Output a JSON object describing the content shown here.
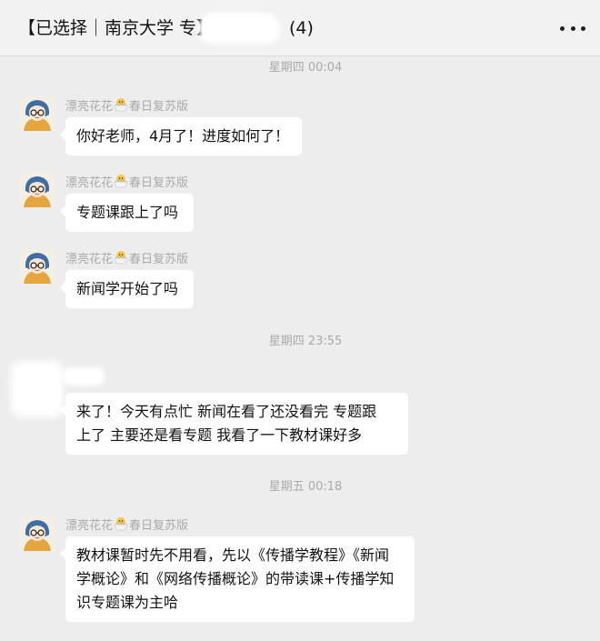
{
  "header": {
    "title": "【已选择｜南京大学 专】",
    "count": "(4)",
    "more_icon": "more-dots-icon"
  },
  "messages": [
    {
      "timestamp": "星期四 00:04",
      "sender_prefix": "漂亮花花",
      "sender_suffix": "春日复苏版",
      "text": "你好老师，4月了！进度如何了！"
    },
    {
      "sender_prefix": "漂亮花花",
      "sender_suffix": "春日复苏版",
      "text": "专题课跟上了吗"
    },
    {
      "sender_prefix": "漂亮花花",
      "sender_suffix": "春日复苏版",
      "text": "新闻学开始了吗"
    },
    {
      "timestamp": "星期四 23:55",
      "text_line1": "来了！今天有点忙  新闻在看了还没看完  专题跟",
      "text_line2": "上了 主要还是看专题 我看了一下教材课好多"
    },
    {
      "timestamp": "星期五 00:18",
      "sender_prefix": "漂亮花花",
      "sender_suffix": "春日复苏版",
      "text_line1": "教材课暂时先不用看，先以《传播学教程》《新闻",
      "text_line2": "学概论》和《网络传播概论》的带读课+传播学知",
      "text_line3": "识专题课为主哈"
    }
  ],
  "colors": {
    "background": "#ededed",
    "bubble": "#ffffff",
    "meta_text": "#a9a9a9"
  }
}
